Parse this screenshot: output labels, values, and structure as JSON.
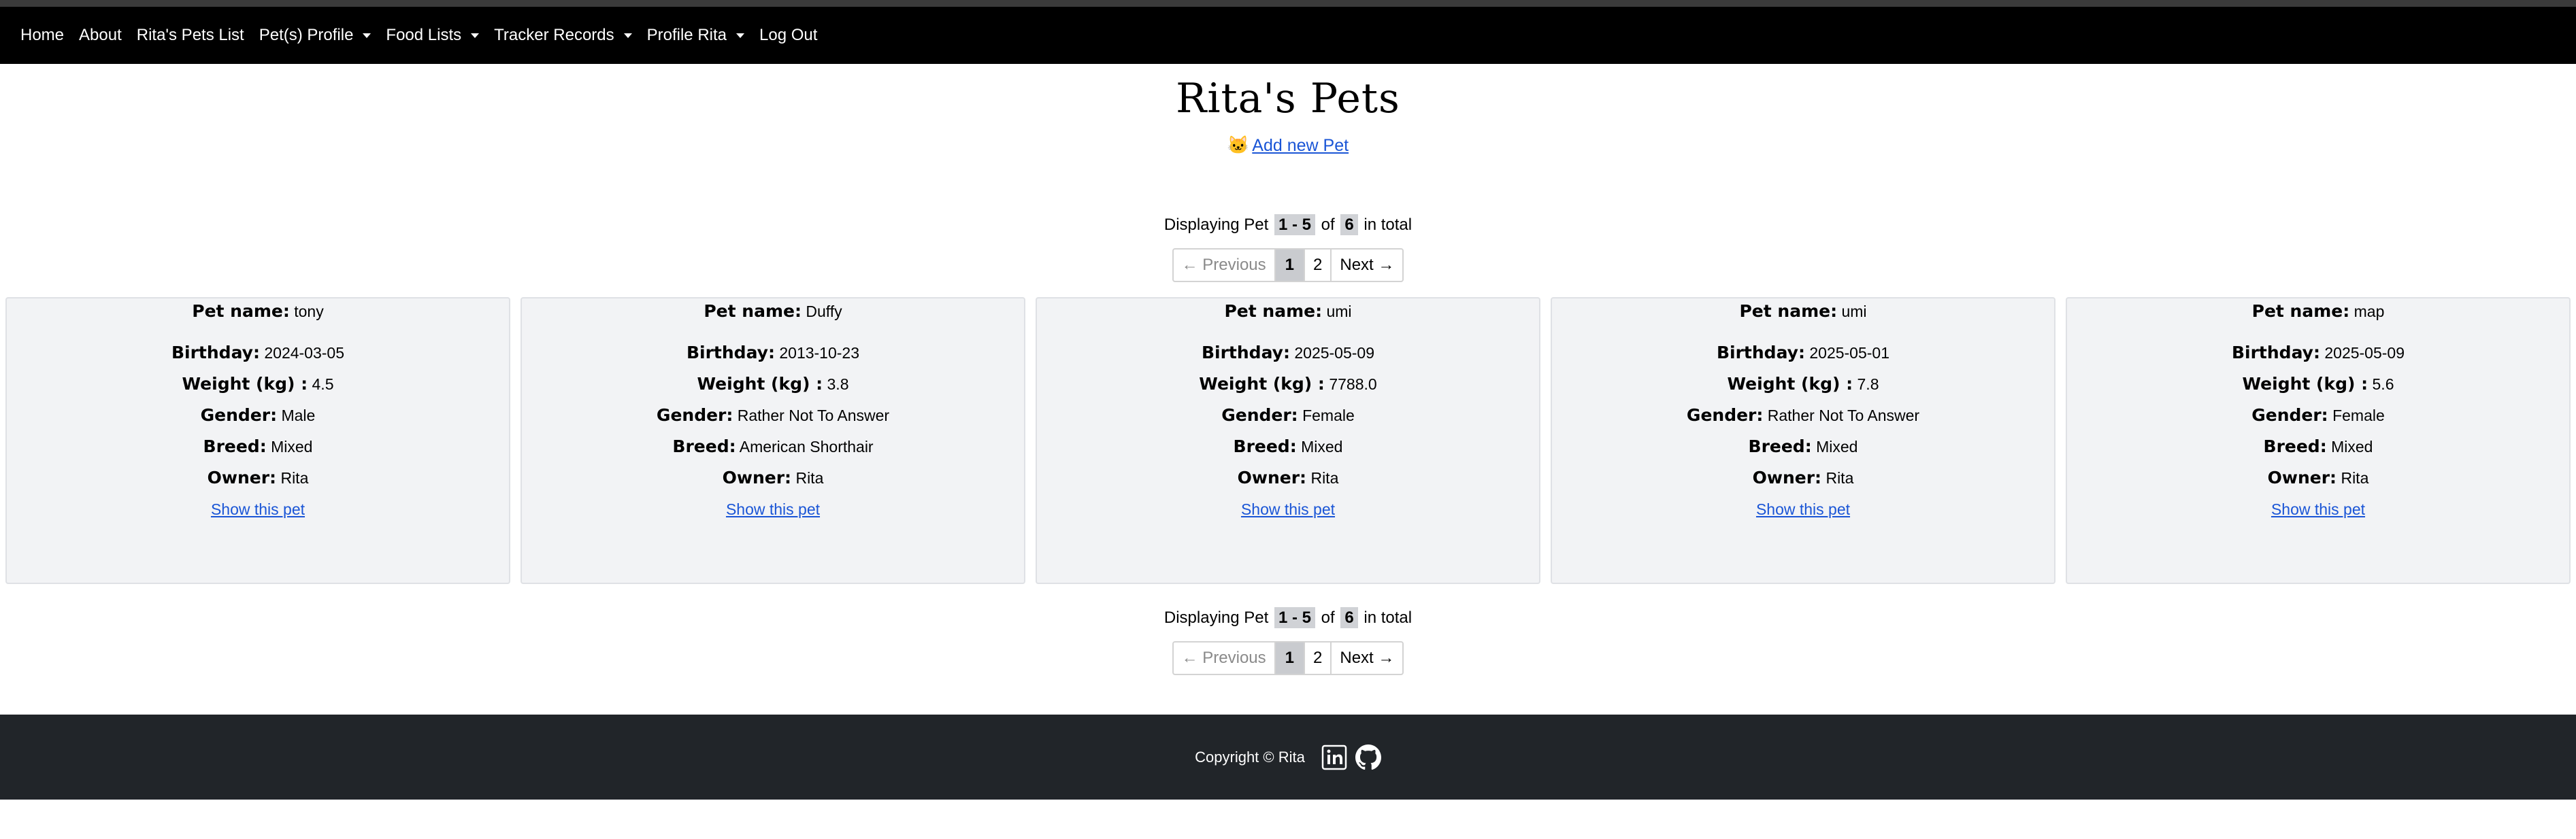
{
  "nav": {
    "home": "Home",
    "about": "About",
    "pets_list": "Rita's Pets List",
    "pet_profile": "Pet(s) Profile",
    "food_lists": "Food Lists",
    "tracker_records": "Tracker Records",
    "profile": "Profile Rita",
    "logout": "Log Out"
  },
  "page": {
    "title": "Rita's Pets",
    "add_new": "Add new Pet"
  },
  "pagination": {
    "displaying": "Displaying Pet",
    "range": "1 - 5",
    "of": "of",
    "total": "6",
    "in_total": "in total",
    "prev": "← Previous",
    "page1": "1",
    "page2": "2",
    "next": "Next →"
  },
  "labels": {
    "name": "Pet name:",
    "birthday": "Birthday:",
    "weight": "Weight (kg) :",
    "gender": "Gender:",
    "breed": "Breed:",
    "owner": "Owner:",
    "show": "Show this pet"
  },
  "pets": [
    {
      "name": "tony",
      "birthday": "2024-03-05",
      "weight": "4.5",
      "gender": "Male",
      "breed": "Mixed",
      "owner": "Rita"
    },
    {
      "name": "Duffy",
      "birthday": "2013-10-23",
      "weight": "3.8",
      "gender": "Rather Not To Answer",
      "breed": "American Shorthair",
      "owner": "Rita"
    },
    {
      "name": "umi",
      "birthday": "2025-05-09",
      "weight": "7788.0",
      "gender": "Female",
      "breed": "Mixed",
      "owner": "Rita"
    },
    {
      "name": "umi",
      "birthday": "2025-05-01",
      "weight": "7.8",
      "gender": "Rather Not To Answer",
      "breed": "Mixed",
      "owner": "Rita"
    },
    {
      "name": "map",
      "birthday": "2025-05-09",
      "weight": "5.6",
      "gender": "Female",
      "breed": "Mixed",
      "owner": "Rita"
    }
  ],
  "footer": {
    "copyright": "Copyright © Rita",
    "icons": [
      "linkedin-icon",
      "github-icon"
    ]
  }
}
